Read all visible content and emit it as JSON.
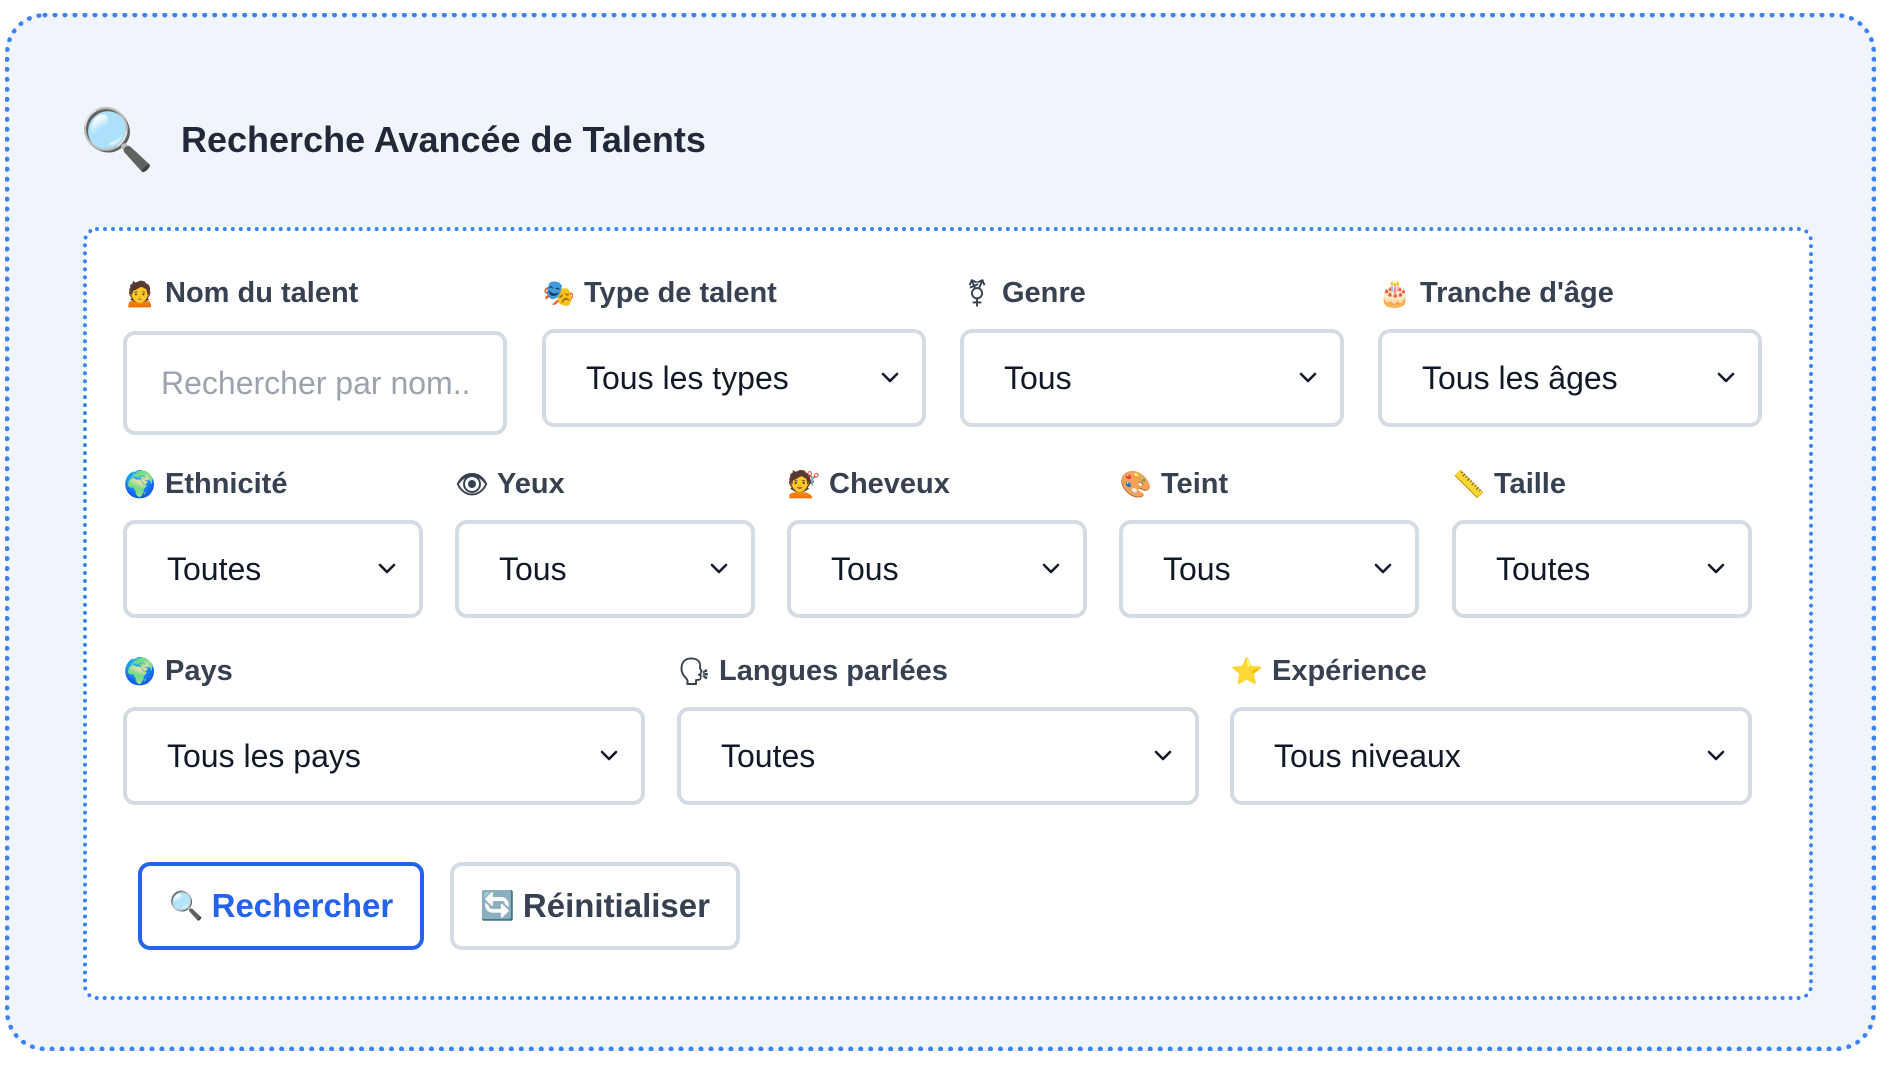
{
  "header": {
    "icon": "magnifier-icon",
    "icon_glyph": "🔍",
    "title": "Recherche Avancée de Talents"
  },
  "fields": {
    "name": {
      "icon": "🙍",
      "label": "Nom du talent",
      "placeholder": "Rechercher par nom..",
      "value": ""
    },
    "type": {
      "icon": "🎭",
      "label": "Type de talent",
      "value": "Tous les types"
    },
    "gender": {
      "icon": "⚧",
      "label": "Genre",
      "value": "Tous"
    },
    "age": {
      "icon": "🎂",
      "label": "Tranche d'âge",
      "value": "Tous les âges"
    },
    "ethnicity": {
      "icon": "🌍",
      "label": "Ethnicité",
      "value": "Toutes"
    },
    "eyes": {
      "icon": "👁",
      "label": "Yeux",
      "value": "Tous"
    },
    "hair": {
      "icon": "💇",
      "label": "Cheveux",
      "value": "Tous"
    },
    "complexion": {
      "icon": "🎨",
      "label": "Teint",
      "value": "Tous"
    },
    "height": {
      "icon": "📏",
      "label": "Taille",
      "value": "Toutes"
    },
    "country": {
      "icon": "🌍",
      "label": "Pays",
      "value": "Tous les pays"
    },
    "languages": {
      "icon": "🗣",
      "label": "Langues parlées",
      "value": "Toutes"
    },
    "experience": {
      "icon": "⭐",
      "label": "Expérience",
      "value": "Tous niveaux"
    }
  },
  "buttons": {
    "search": {
      "icon": "🔍",
      "label": "Rechercher"
    },
    "reset": {
      "icon": "🔄",
      "label": "Réinitialiser"
    }
  },
  "colors": {
    "accent": "#3b82f6",
    "primary_button": "#2563eb",
    "panel_background": "#f0f5fc",
    "field_border": "#d5dbe3"
  }
}
